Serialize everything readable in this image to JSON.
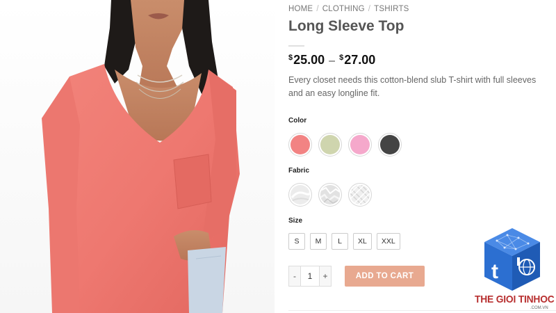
{
  "breadcrumb": {
    "items": [
      "HOME",
      "CLOTHING",
      "TSHIRTS"
    ],
    "separator": "/"
  },
  "product": {
    "title": "Long Sleeve Top",
    "price_min_symbol": "$",
    "price_min": "25.00",
    "price_sep": "–",
    "price_max_symbol": "$",
    "price_max": "27.00",
    "description": "Every closet needs this cotton-blend slub T-shirt with full sleeves and an easy longline fit."
  },
  "options": {
    "color": {
      "label": "Color",
      "swatches": [
        {
          "name": "coral",
          "hex": "#f28383"
        },
        {
          "name": "sage",
          "hex": "#cfd5ae"
        },
        {
          "name": "pink",
          "hex": "#f5a8cb"
        },
        {
          "name": "charcoal",
          "hex": "#444444"
        }
      ]
    },
    "fabric": {
      "label": "Fabric",
      "swatches": [
        "fabric-smooth",
        "fabric-crinkled",
        "fabric-knit"
      ]
    },
    "size": {
      "label": "Size",
      "values": [
        "S",
        "M",
        "L",
        "XL",
        "XXL"
      ]
    }
  },
  "cart": {
    "decrement": "-",
    "quantity": "1",
    "increment": "+",
    "add_label": "ADD TO CART"
  },
  "watermark": {
    "brand": "THE GIOI TINHOC",
    "domain": ".COM.VN",
    "colors": {
      "cube": "#2c6fd1",
      "text": "#b83030"
    }
  },
  "colors": {
    "accent_button": "#e8a990",
    "shirt": "#f07a72"
  }
}
